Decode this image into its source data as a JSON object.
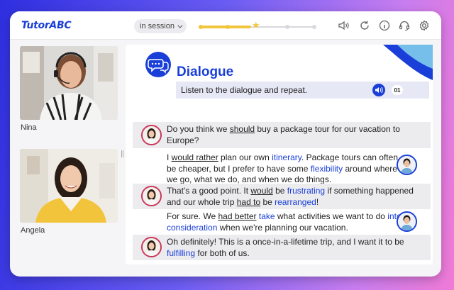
{
  "app": {
    "logo": "TutorABC"
  },
  "toolbar": {
    "session_label": "in session",
    "progress_fraction": 0.45,
    "icons": [
      "speaker-icon",
      "refresh-icon",
      "info-icon",
      "headset-icon",
      "gear-icon"
    ]
  },
  "participants": [
    {
      "name": "Nina"
    },
    {
      "name": "Angela"
    }
  ],
  "lesson": {
    "title": "Dialogue",
    "instruction": "Listen to the dialogue and repeat.",
    "track_number": "01"
  },
  "dialogue": [
    {
      "speaker": "female",
      "segments": [
        {
          "t": "Do you think we "
        },
        {
          "t": "should",
          "style": "ul"
        },
        {
          "t": " buy a package tour for our vacation to"
        }
      ],
      "line2": [
        {
          "t": "Europe?"
        }
      ]
    },
    {
      "speaker": "male",
      "segments": [
        {
          "t": "I "
        },
        {
          "t": "would rather",
          "style": "ul"
        },
        {
          "t": " plan our own "
        },
        {
          "t": "itinerary",
          "style": "kw"
        },
        {
          "t": ". Package tours can often"
        }
      ],
      "line2": [
        {
          "t": "be cheaper, but I prefer to have some "
        },
        {
          "t": "flexibility",
          "style": "kw"
        },
        {
          "t": " around where"
        }
      ],
      "line3": [
        {
          "t": "we go, what we do, and when we do things."
        }
      ]
    },
    {
      "speaker": "female",
      "segments": [
        {
          "t": "That's a good point. It "
        },
        {
          "t": "would",
          "style": "ul"
        },
        {
          "t": " be "
        },
        {
          "t": "frustrating",
          "style": "kw"
        },
        {
          "t": " if something happened"
        }
      ],
      "line2": [
        {
          "t": "and our whole trip "
        },
        {
          "t": "had to",
          "style": "ul"
        },
        {
          "t": " be "
        },
        {
          "t": "rearranged",
          "style": "kw"
        },
        {
          "t": "!"
        }
      ]
    },
    {
      "speaker": "male",
      "segments": [
        {
          "t": "For sure. We "
        },
        {
          "t": "had better",
          "style": "ul"
        },
        {
          "t": " "
        },
        {
          "t": "take",
          "style": "kw"
        },
        {
          "t": " what activities we want to do "
        },
        {
          "t": "into",
          "style": "kw"
        }
      ],
      "line2": [
        {
          "t": "consideration",
          "style": "kw"
        },
        {
          "t": " when we're planning our vacation."
        }
      ]
    },
    {
      "speaker": "female",
      "segments": [
        {
          "t": "Oh definitely! This is a once-in-a-lifetime trip, and I want it to be"
        }
      ],
      "line2": [
        {
          "t": "fulfilling",
          "style": "kw"
        },
        {
          "t": " for both of us."
        }
      ]
    }
  ],
  "colors": {
    "accent": "#1a3fd8",
    "female_ring": "#c8365b",
    "progress": "#f1c53c"
  }
}
